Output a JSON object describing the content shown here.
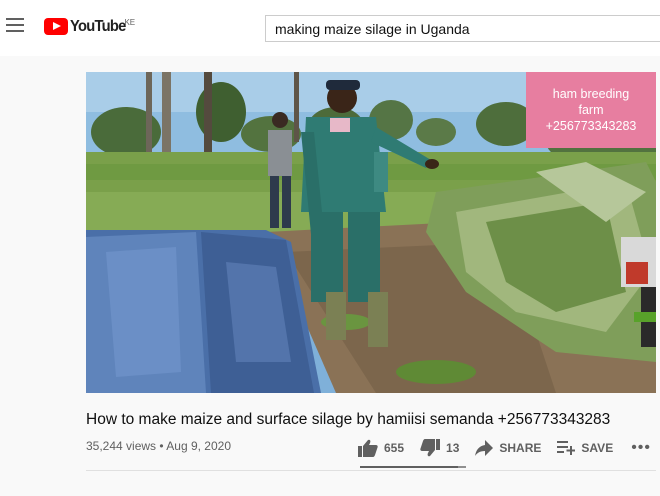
{
  "header": {
    "logo_text": "YouTube",
    "country_code": "KE",
    "search_value": "making maize silage in Uganda"
  },
  "video": {
    "overlay_text_line1": "ham breeding",
    "overlay_text_line2": "farm",
    "overlay_text_line3": "+256773343283",
    "title": "How to make maize and surface silage by hamiisi semanda +256773343283",
    "views": "35,244 views",
    "separator": "•",
    "date": "Aug 9, 2020",
    "likes": "655",
    "dislikes": "13",
    "like_fraction": 0.92
  },
  "actions": {
    "share_label": "SHARE",
    "save_label": "SAVE",
    "more_label": "•••"
  },
  "icons": [
    "menu-icon",
    "youtube-logo-icon",
    "thumb-up-icon",
    "thumb-down-icon",
    "share-icon",
    "add-to-playlist-icon",
    "more-icon"
  ],
  "colors": {
    "brand_red": "#ff0000",
    "overlay_pink": "#e77ea0",
    "text_dark": "#0f0f0f",
    "text_gray": "#606060"
  }
}
